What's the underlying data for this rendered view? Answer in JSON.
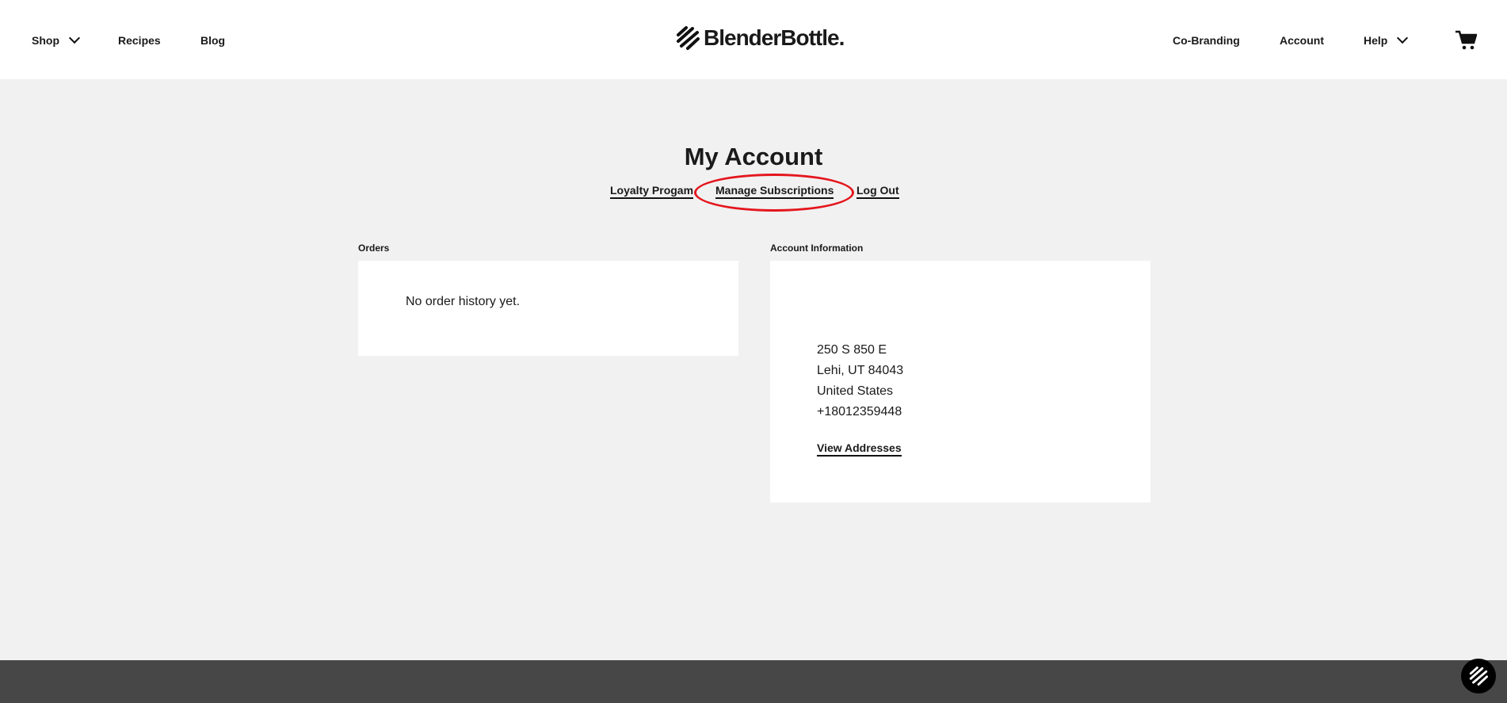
{
  "header": {
    "nav_left": [
      "Shop",
      "Recipes",
      "Blog"
    ],
    "logo": "BlenderBottle.",
    "nav_right": [
      "Co-Branding",
      "Account",
      "Help"
    ]
  },
  "page": {
    "title": "My Account",
    "links": [
      "Loyalty Progam",
      "Manage Subscriptions",
      "Log Out"
    ],
    "highlight_color": "#e4161d"
  },
  "orders": {
    "label": "Orders",
    "empty": "No order history yet."
  },
  "account": {
    "label": "Account Information",
    "address": [
      "250 S 850 E",
      "Lehi, UT 84043",
      "United States",
      "+18012359448"
    ],
    "view_addresses": "View Addresses"
  }
}
